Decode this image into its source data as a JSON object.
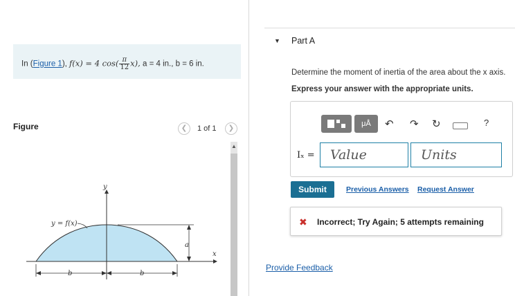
{
  "problem": {
    "prefix": "In (",
    "figure_link": "Figure 1",
    "suffix_paren": "),",
    "func_lhs": "f(x) = 4 cos(",
    "frac_num": "π",
    "frac_den": "12",
    "func_rhs": "x),",
    "params": "a = 4 in., b = 6 in."
  },
  "figure_panel": {
    "label": "Figure",
    "prev_icon": "chevron-left-icon",
    "next_icon": "chevron-right-icon",
    "page_indicator": "1 of 1",
    "diagram": {
      "y_axis_label": "y",
      "x_axis_label": "x",
      "curve_label": "y = f(x)",
      "height_label": "a",
      "left_width_label": "b",
      "right_width_label": "b",
      "fill_color": "#bfe3f3"
    }
  },
  "part": {
    "caret_icon": "caret-down-icon",
    "title": "Part A",
    "question": "Determine the moment of inertia of the area about the x axis.",
    "instruction": "Express your answer with the appropriate units."
  },
  "toolbar": {
    "templates_icon": "templates-icon",
    "units_label": "μÅ",
    "undo_icon": "undo-icon",
    "redo_icon": "redo-icon",
    "reset_icon": "reset-icon",
    "keyboard_icon": "keyboard-icon",
    "help_label": "?"
  },
  "answer": {
    "variable_label": "Iₓ =",
    "value_placeholder": "Value",
    "units_placeholder": "Units"
  },
  "actions": {
    "submit_label": "Submit",
    "previous_answers_label": "Previous Answers",
    "request_answer_label": "Request Answer"
  },
  "feedback": {
    "status_icon": "x-mark-icon",
    "message": "Incorrect; Try Again; 5 attempts remaining",
    "error_color": "#c9302c"
  },
  "footer": {
    "provide_feedback_label": "Provide Feedback"
  },
  "colors": {
    "accent": "#1b6f93",
    "link": "#1a5ea8",
    "problem_bg": "#eaf3f6"
  }
}
